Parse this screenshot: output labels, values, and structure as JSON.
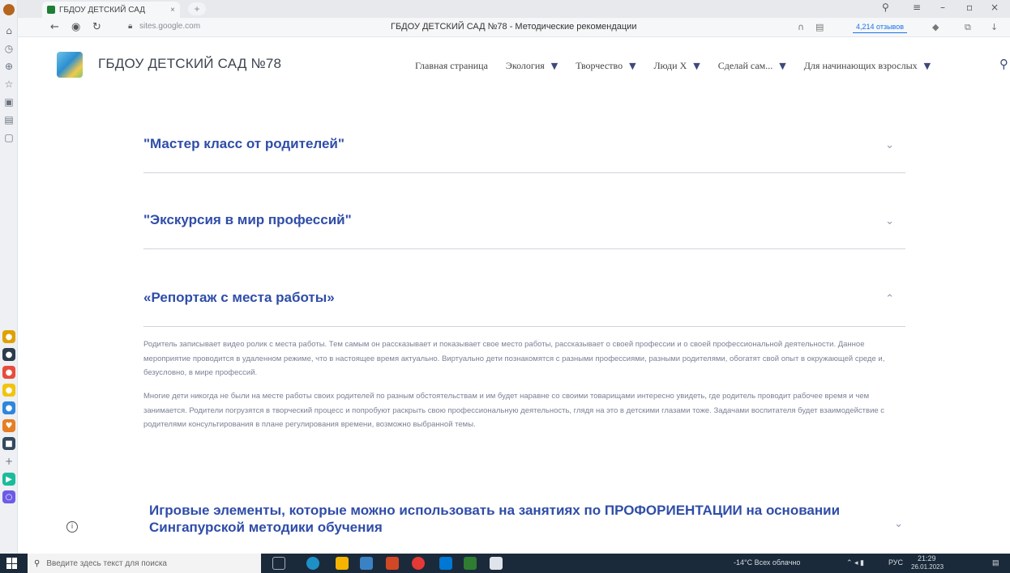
{
  "browser": {
    "tab_title": "ГБДОУ ДЕТСКИЙ САД",
    "tab_close": "×",
    "new_tab": "+",
    "url": "sites.google.com",
    "page_title": "ГБДОУ ДЕТСКИЙ САД №78 - Методические рекомендации",
    "reviews_label": "4,214 отзывов"
  },
  "site": {
    "title": "ГБДОУ ДЕТСКИЙ САД №78",
    "menu": [
      {
        "label": "Главная страница",
        "has_dropdown": false
      },
      {
        "label": "Экология",
        "has_dropdown": true
      },
      {
        "label": "Творчество",
        "has_dropdown": true
      },
      {
        "label": "Люди Х",
        "has_dropdown": true
      },
      {
        "label": "Сделай сам...",
        "has_dropdown": true
      },
      {
        "label": "Для начинающих взрослых",
        "has_dropdown": true
      }
    ]
  },
  "sections": [
    {
      "title": "\"Мастер класс  от родителей\"",
      "expanded": false
    },
    {
      "title": "\"Экскурсия  в мир профессий\"",
      "expanded": false
    },
    {
      "title": "«Репортаж с места работы»",
      "expanded": true,
      "paragraphs": [
        "Родитель записывает видео ролик с места работы. Тем самым он рассказывает и показывает свое место работы, рассказывает о своей профессии и о своей профессиональной деятельности. Данное мероприятие проводится в удаленном режиме, что в настоящее время актуально. Виртуально дети познакомятся с разными профессиями, разными родителями, обогатят свой опыт в окружающей среде и, безусловно, в мире профессий.",
        "Многие дети никогда не были на месте работы своих родителей по разным обстоятельствам и им будет наравне со своими товарищами интересно увидеть, где родитель проводит рабочее время и чем занимается. Родители погрузятся в творческий процесс и попробуют раскрыть свою профессиональную деятельность, глядя на это в детскими глазами тоже. Задачами воспитателя будет взаимодействие с родителями консультирования в плане регулирования времени, возможно выбранной темы."
      ]
    },
    {
      "title": "Игровые элементы, которые можно использовать на занятиях по ПРОФОРИЕНТАЦИИ на основании Сингапурской методики обучения",
      "expanded": false
    }
  ],
  "taskbar": {
    "search_placeholder": "Введите здесь текст для поиска",
    "weather": "-14°C Всех облачно",
    "lang": "РУС",
    "time": "21:29",
    "date": "26.01.2023"
  },
  "colors": {
    "heading": "#2f4da8",
    "body_text": "#7a8296",
    "divider": "#cfd4dd",
    "taskbar": "#1b2a3a"
  }
}
